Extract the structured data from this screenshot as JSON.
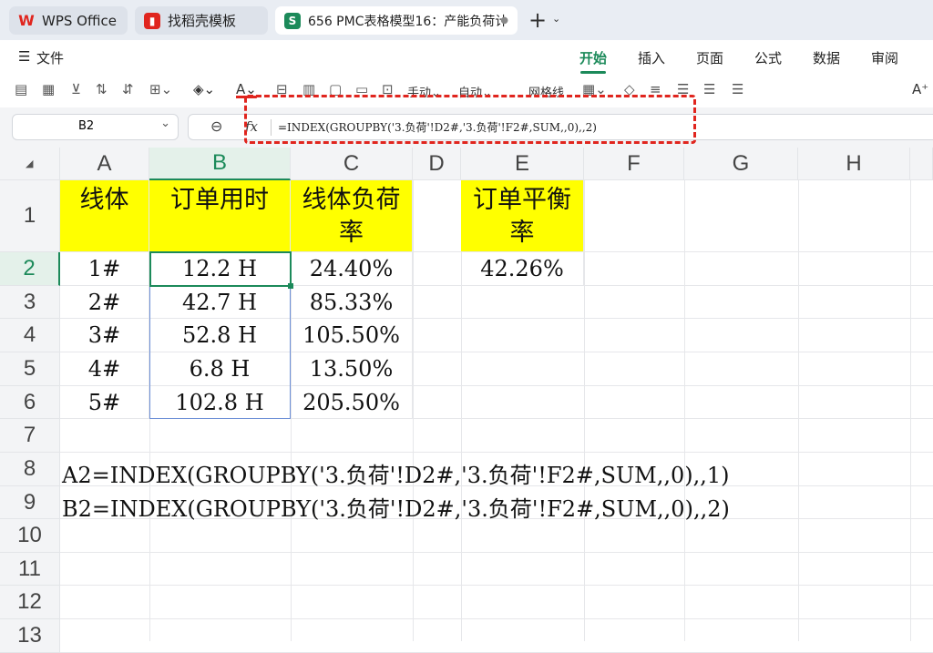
{
  "tabs": [
    {
      "label": "WPS Office",
      "icon": "wps-logo-icon"
    },
    {
      "label": "找稻壳模板",
      "icon": "docer-icon"
    },
    {
      "label": "656 PMC表格模型16：产能负荷计",
      "icon": "spreadsheet-icon",
      "icon_letter": "S"
    }
  ],
  "menu": {
    "file_label": "文件",
    "items": [
      "开始",
      "插入",
      "页面",
      "公式",
      "数据",
      "审阅"
    ],
    "active": "开始"
  },
  "toolbar": {
    "manual_label": "手动",
    "auto_label": "自动",
    "gridlines_label": "网格线",
    "gridlines_checked": true,
    "font_name": "宋体",
    "font_color": "#e0251e",
    "highlight_color": "#ffd400"
  },
  "formula_bar": {
    "name_box": "B2",
    "fx_label": "fx",
    "formula": "=INDEX(GROUPBY('3.负荷'!D2#,'3.负荷'!F2#,SUM,,0),,2)"
  },
  "sheet": {
    "columns": [
      "A",
      "B",
      "C",
      "D",
      "E",
      "F",
      "G",
      "H"
    ],
    "selected_column": "B",
    "rows": [
      "1",
      "2",
      "3",
      "4",
      "5",
      "6",
      "7",
      "8",
      "9",
      "10",
      "11",
      "12",
      "13"
    ],
    "selected_row": "2",
    "headers": {
      "a1": "线体",
      "b1": "订单用时",
      "c1": "线体负荷率",
      "e1": "订单平衡率"
    },
    "data_rows": [
      {
        "a": "1#",
        "b": "12.2 H",
        "c": "24.40%"
      },
      {
        "a": "2#",
        "b": "42.7 H",
        "c": "85.33%"
      },
      {
        "a": "3#",
        "b": "52.8 H",
        "c": "105.50%"
      },
      {
        "a": "4#",
        "b": "6.8 H",
        "c": "13.50%"
      },
      {
        "a": "5#",
        "b": "102.8 H",
        "c": "205.50%"
      }
    ],
    "e2": "42.26%",
    "notes": [
      "A2=INDEX(GROUPBY('3.负荷'!D2#,'3.负荷'!F2#,SUM,,0),,1)",
      "B2=INDEX(GROUPBY('3.负荷'!D2#,'3.负荷'!F2#,SUM,,0),,2)"
    ],
    "header_fill": "#ffff00",
    "accent": "#1c8a5a"
  }
}
